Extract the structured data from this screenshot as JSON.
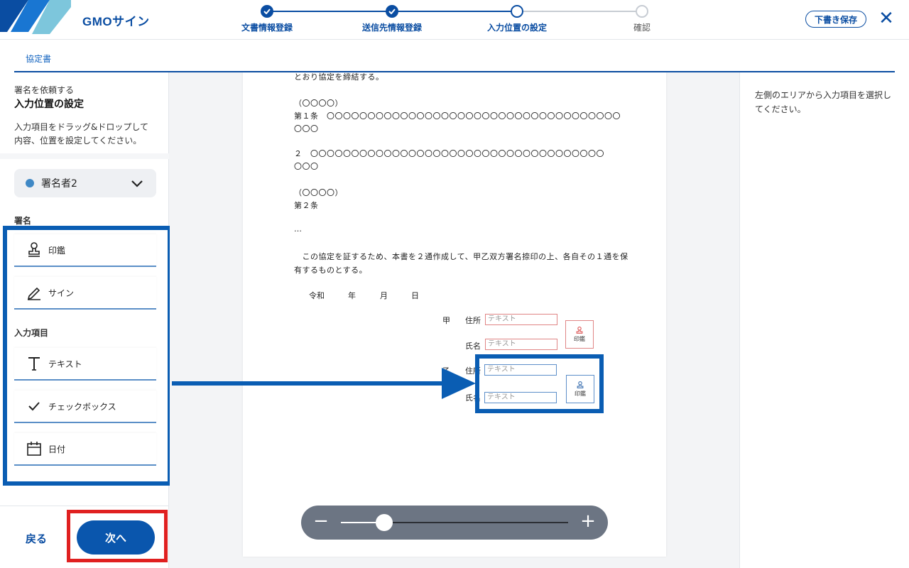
{
  "header": {
    "brand": "GMOサイン",
    "steps": [
      {
        "label": "文書情報登録",
        "state": "done"
      },
      {
        "label": "送信先情報登録",
        "state": "done"
      },
      {
        "label": "入力位置の設定",
        "state": "current"
      },
      {
        "label": "確認",
        "state": "todo"
      }
    ],
    "draft_save": "下書き保存",
    "close_icon": "close-icon"
  },
  "tabs": [
    {
      "label": "協定書"
    }
  ],
  "left_panel": {
    "subtitle": "署名を依頼する",
    "title": "入力位置の設定",
    "description": "入力項目をドラッグ&ドロップして内容、位置を設定してください。",
    "signer_select": {
      "value": "署名者2",
      "dot_color": "#3f88c5"
    },
    "sections": [
      {
        "label": "署名",
        "items": [
          {
            "label": "印鑑",
            "icon": "stamp-icon"
          },
          {
            "label": "サイン",
            "icon": "pen-icon"
          }
        ]
      },
      {
        "label": "入力項目",
        "items": [
          {
            "label": "テキスト",
            "icon": "text-icon"
          },
          {
            "label": "チェックボックス",
            "icon": "check-icon"
          },
          {
            "label": "日付",
            "icon": "calendar-icon"
          }
        ]
      }
    ],
    "back": "戻る",
    "next": "次へ"
  },
  "document": {
    "lines": [
      "とおり協定を締結する。",
      "（〇〇〇〇）",
      "第１条　〇〇〇〇〇〇〇〇〇〇〇〇〇〇〇〇〇〇〇〇〇〇〇〇〇〇〇〇〇〇〇〇〇〇〇〇",
      "〇〇〇",
      "２　〇〇〇〇〇〇〇〇〇〇〇〇〇〇〇〇〇〇〇〇〇〇〇〇〇〇〇〇〇〇〇〇〇〇〇〇",
      "〇〇〇",
      "（〇〇〇〇）",
      "第２条",
      "…",
      "　この協定を証するため、本書を２通作成して、甲乙双方署名捺印の上、各自その１通を保",
      "有するものとする。"
    ],
    "date_labels": [
      "令和",
      "年",
      "月",
      "日"
    ],
    "party_a": {
      "mark": "甲",
      "address_label": "住所",
      "name_label": "氏名",
      "field_placeholder": "テキスト",
      "stamp_label": "印鑑"
    },
    "party_b": {
      "mark": "乙",
      "address_label": "住所",
      "name_label": "氏名",
      "field_placeholder": "テキスト",
      "stamp_label": "印鑑"
    }
  },
  "zoom": {
    "level": 0.19
  },
  "right_panel": {
    "hint": "左側のエリアから入力項目を選択してください。"
  },
  "colors": {
    "primary": "#0a4da2",
    "highlight_blue": "#0a5db3",
    "highlight_red": "#e02020",
    "field_red": "#e08585",
    "field_blue": "#5d8fc9"
  }
}
